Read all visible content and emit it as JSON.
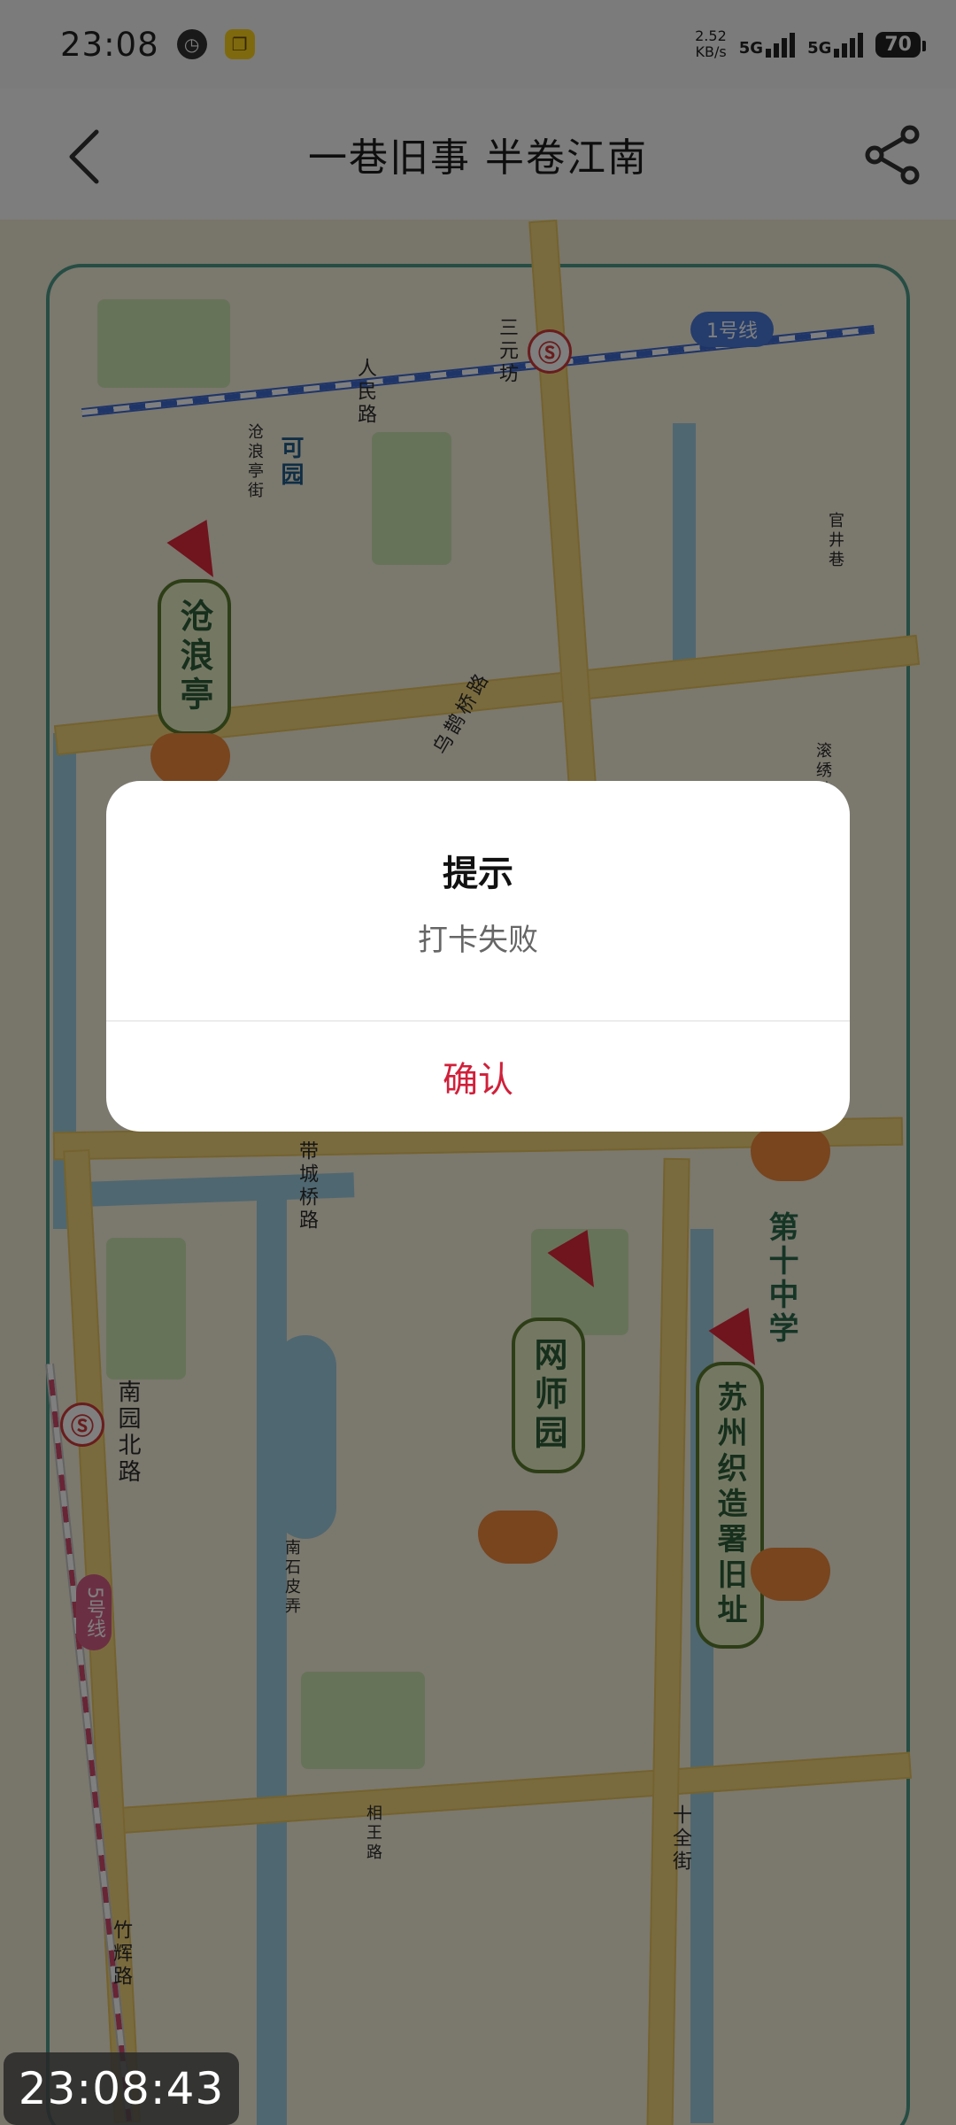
{
  "status_bar": {
    "time": "23:08",
    "net_speed_value": "2.52",
    "net_speed_unit": "KB/s",
    "signal_1": "5G",
    "signal_2": "5G",
    "battery": "70"
  },
  "header": {
    "title": "一巷旧事 半卷江南"
  },
  "map": {
    "labels": {
      "sanyuanfang": "三元坊",
      "renmin_road": "人民路",
      "line1": "1号线",
      "keyuan": "可园",
      "canglangting_lane": "沧浪亭街",
      "wuqiao_road": "乌鹊桥路",
      "daicheng_bridge_road": "带城桥路",
      "nanyuan_north_road": "南园北路",
      "line5": "5号线",
      "no10_school": "第十中学",
      "shiquan_street": "十全街",
      "zhuhui_road": "竹辉路",
      "xiangwang_road": "相王路",
      "nanshipi_lane": "南石皮弄",
      "fengjing_lane": "滚绣坊",
      "guanjing_lane": "官井巷"
    },
    "places": {
      "canglangting": "沧浪亭",
      "wangshiyuan": "网师园",
      "zhizao": "苏州织造署旧址"
    },
    "metro_icon": "metro-logo-icon"
  },
  "dialog": {
    "title": "提示",
    "message": "打卡失败",
    "confirm": "确认"
  },
  "clock_overlay": "23:08:43"
}
